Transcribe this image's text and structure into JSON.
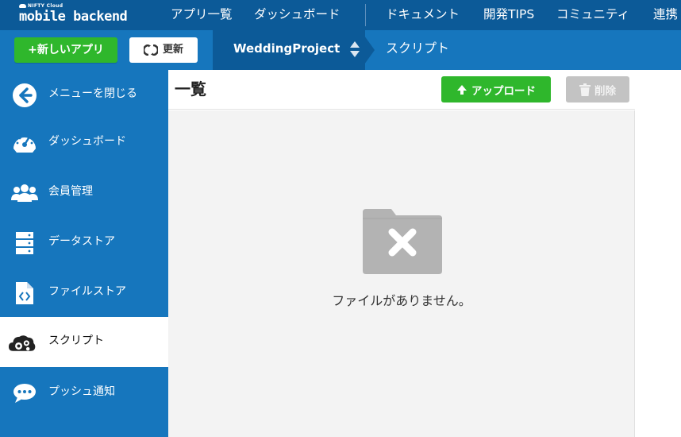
{
  "brand": {
    "small": "NIFTY Cloud",
    "name": "mobile backend"
  },
  "topnav": [
    {
      "label": "アプリ一覧"
    },
    {
      "label": "ダッシュボード"
    },
    {
      "label": "ドキュメント"
    },
    {
      "label": "開発TIPS"
    },
    {
      "label": "コミュニティ"
    },
    {
      "label": "連携"
    }
  ],
  "subbar": {
    "new_app_label": "+新しいアプリ",
    "refresh_label": "更新",
    "project_name": "WeddingProject",
    "breadcrumb": "スクリプト"
  },
  "sidebar": {
    "items": [
      {
        "label": "メニューを閉じる",
        "icon": "back-arrow-icon"
      },
      {
        "label": "ダッシュボード",
        "icon": "gauge-icon"
      },
      {
        "label": "会員管理",
        "icon": "users-icon"
      },
      {
        "label": "データストア",
        "icon": "database-icon"
      },
      {
        "label": "ファイルストア",
        "icon": "code-file-icon"
      },
      {
        "label": "スクリプト",
        "icon": "script-cloud-gears-icon",
        "active": true
      },
      {
        "label": "プッシュ通知",
        "icon": "chat-bubble-icon"
      }
    ]
  },
  "main": {
    "title": "一覧",
    "upload_label": "アップロード",
    "delete_label": "削除",
    "empty_message": "ファイルがありません。"
  },
  "colors": {
    "topbar": "#0c5a98",
    "subbar": "#1676bd",
    "accent_green": "#2fb72c",
    "disabled_gray": "#c3c3c3"
  }
}
